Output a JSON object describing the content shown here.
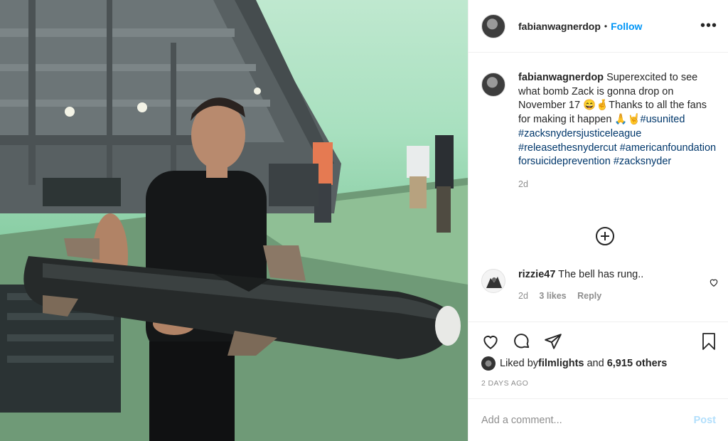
{
  "post": {
    "photo_alt": "Man holding a large missile prop on a film set with green screen background"
  },
  "header": {
    "username": "fabianwagnerdop",
    "separator": "•",
    "follow_label": "Follow",
    "more_icon": "more-horizontal-icon"
  },
  "caption": {
    "username": "fabianwagnerdop",
    "text_part1": " Superexcited to see what bomb Zack is gonna drop on November 17 😄🤞Thanks to all the fans for making it happen 🙏🤘",
    "hashtags": [
      "#usunited",
      "#zacksnydersjusticeleague",
      "#releasethesnydercut",
      "#americanfoundationforsuicideprevention",
      "#zacksnyder"
    ],
    "time": "2d"
  },
  "load_more_icon": "plus-circle-icon",
  "comments": [
    {
      "username": "rizzie47",
      "text": " The bell has rung..",
      "time": "2d",
      "likes": "3 likes",
      "reply_label": "Reply"
    }
  ],
  "actions": {
    "like_icon": "heart-icon",
    "comment_icon": "comment-icon",
    "share_icon": "share-icon",
    "save_icon": "bookmark-icon"
  },
  "likes": {
    "prefix": "Liked by ",
    "user": "filmlights",
    "middle": " and ",
    "others": "6,915 others"
  },
  "timestamp": "2 DAYS AGO",
  "add_comment": {
    "placeholder": "Add a comment...",
    "post_label": "Post",
    "post_color": "#b2dffc"
  },
  "colors": {
    "link": "#00376b",
    "follow": "#0095f6",
    "muted": "#8e8e8e"
  }
}
